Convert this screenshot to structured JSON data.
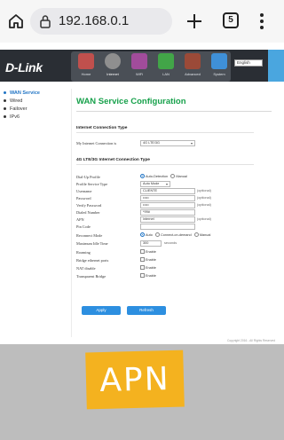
{
  "browser": {
    "url": "192.168.0.1",
    "tab_count": "5"
  },
  "router": {
    "logo": "D-Link",
    "nav": [
      {
        "label": "Home",
        "color": "#c0504d"
      },
      {
        "label": "Internet",
        "color": "#8f8f8f"
      },
      {
        "label": "WiFi",
        "color": "#a14c9b"
      },
      {
        "label": "LAN",
        "color": "#42a548"
      },
      {
        "label": "Advanced",
        "color": "#9b4a38"
      },
      {
        "label": "System",
        "color": "#3f90d8"
      }
    ],
    "language": "English",
    "sidebar": [
      {
        "label": "WAN Service",
        "active": true
      },
      {
        "label": "Wired",
        "active": false
      },
      {
        "label": "Failover",
        "active": false
      },
      {
        "label": "IPv6",
        "active": false
      }
    ],
    "page_title": "WAN Service Configuration",
    "section1_title": "Internet Connection Type",
    "my_connection_label": "My Internet Connection is",
    "my_connection_value": "4G LTE/3G",
    "section2_title": "4G LTE/3G Internet Connection Type",
    "fields": {
      "dialup_label": "Dial-Up Profile",
      "dialup_opt1": "Auto-Detection",
      "dialup_opt2": "Manual",
      "profile_type_label": "Profile Service Type",
      "profile_type_value": "Auto Mode",
      "username_label": "Username",
      "username_value": "CLIENTE",
      "password_label": "Password",
      "password_value": "•••••",
      "verify_label": "Verify Password",
      "verify_value": "•••••",
      "dialed_label": "Dialed Number",
      "dialed_value": "*99#",
      "apn_label": "APN",
      "apn_value": "internet",
      "pin_label": "Pin Code",
      "pin_value": "",
      "optional": "(optional)",
      "reconnect_label": "Reconnect Mode",
      "reconnect_opt1": "Auto",
      "reconnect_opt2": "Connect-on-demand",
      "reconnect_opt3": "Manual",
      "idle_label": "Maximum Idle Time",
      "idle_value": "300",
      "idle_unit": "seconds",
      "roaming_label": "Roaming",
      "bridge_label": "Bridge ethernet ports",
      "nat_label": "NAT disable",
      "transparent_label": "Transparent Bridge",
      "enable": "Enable"
    },
    "apply_label": "Apply",
    "refresh_label": "Refresh",
    "copyright": "Copyright 2016 - All Rights Reserved"
  },
  "overlay": {
    "text": "APN",
    "card_color": "#f4b21f"
  }
}
